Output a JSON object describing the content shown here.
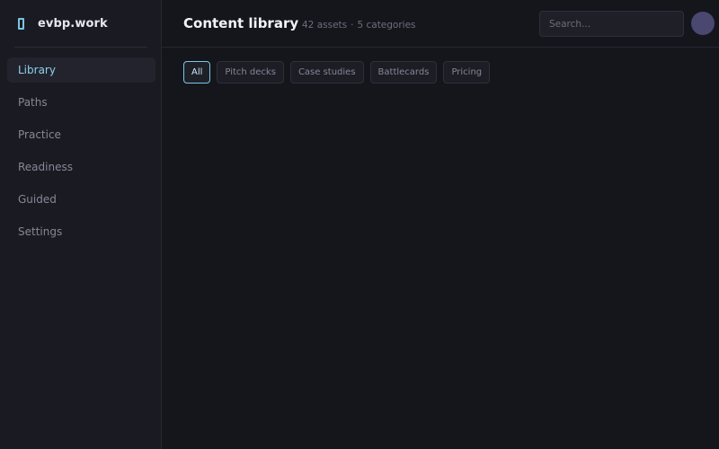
{
  "brand": {
    "name": "evbp.work",
    "logo_icon": "bracket-logo-icon",
    "accent_color": "#7cc4e4"
  },
  "sidebar": {
    "items": [
      {
        "label": "Library",
        "active": true
      },
      {
        "label": "Paths",
        "active": false
      },
      {
        "label": "Practice",
        "active": false
      },
      {
        "label": "Readiness",
        "active": false
      },
      {
        "label": "Guided",
        "active": false
      },
      {
        "label": "Settings",
        "active": false
      }
    ]
  },
  "header": {
    "title": "Content library",
    "assets": "42 assets",
    "separator": "·",
    "categories": "5 categories"
  },
  "search": {
    "placeholder": "Search...",
    "value": ""
  },
  "user": {
    "avatar_color": "#4a4870"
  },
  "filters": [
    {
      "label": "All",
      "active": true
    },
    {
      "label": "Pitch decks",
      "active": false
    },
    {
      "label": "Case studies",
      "active": false
    },
    {
      "label": "Battlecards",
      "active": false
    },
    {
      "label": "Pricing",
      "active": false
    }
  ]
}
